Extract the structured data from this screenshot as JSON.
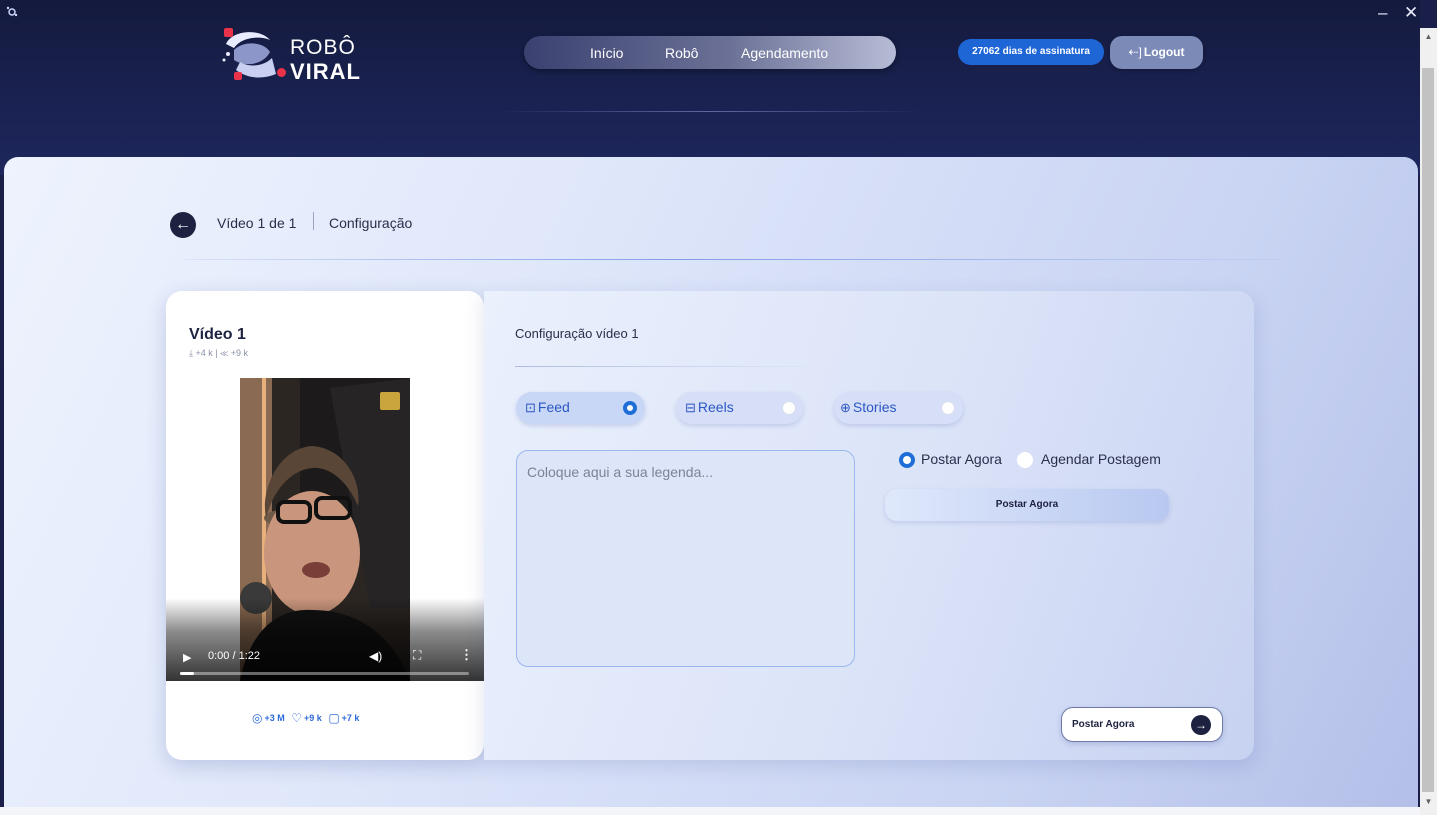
{
  "window": {
    "minimize": "–",
    "close": "✕"
  },
  "brand": {
    "line1": "ROBÔ",
    "line2": "VIRAL",
    "logo_icon": "robot-viral-logo"
  },
  "nav": {
    "items": [
      "Início",
      "Robô",
      "Agendamento"
    ]
  },
  "header": {
    "subscription_badge": "27062 dias de assinatura",
    "logout_label": "Logout",
    "logout_icon": "logout-icon"
  },
  "breadcrumb": {
    "back_icon": "arrow-left-icon",
    "video": "Vídeo 1 de 1",
    "section": "Configuração"
  },
  "video_card": {
    "title": "Vídeo 1",
    "downloads": "+4 k",
    "shares": "+9 k",
    "player": {
      "time": "0:00 / 1:22",
      "progress": 0.05
    },
    "stats": {
      "views": "+3 M",
      "likes": "+9 k",
      "comments": "+7 k"
    }
  },
  "config": {
    "title": "Configuração vídeo 1",
    "types": [
      {
        "label": "Feed",
        "icon": "instagram-icon",
        "selected": true
      },
      {
        "label": "Reels",
        "icon": "reels-icon",
        "selected": false
      },
      {
        "label": "Stories",
        "icon": "stories-icon",
        "selected": false
      }
    ],
    "caption_placeholder": "Coloque aqui a sua legenda...",
    "modes": [
      {
        "label": "Postar Agora",
        "selected": true
      },
      {
        "label": "Agendar Postagem",
        "selected": false
      }
    ],
    "post_now_wide_label": "Postar Agora",
    "post_now_button_label": "Postar Agora"
  },
  "colors": {
    "accent": "#1f6ed8",
    "dark": "#1d2240",
    "header_bg": "#141a3d"
  }
}
